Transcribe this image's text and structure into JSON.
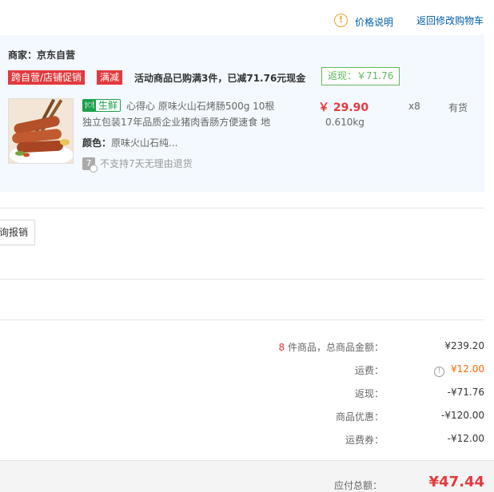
{
  "header": {
    "price_desc": "价格说明",
    "back_to_cart": "返回修改购物车"
  },
  "shop": {
    "merchant_label": "商家：",
    "merchant_name": "京东自营",
    "promo_tags": [
      "跨自营/店铺促销",
      "满减"
    ],
    "promo_text": "活动商品已购满3件，已减71.76元现金",
    "cashback": "返现：￥71.76"
  },
  "item": {
    "fresh_icon": "🍽",
    "fresh_label": "生鲜",
    "title_line1": "心得心 原味火山石烤肠500g 10根",
    "title_line2": "独立包装17年品质企业猪肉香肠方便速食 地",
    "color_label": "颜色：",
    "color_value": "原味火山石纯...",
    "return_icon": "7",
    "return_text": "不支持7天无理由退货",
    "price": "￥ 29.90",
    "weight": "0.610kg",
    "qty": "x8",
    "stock": "有货"
  },
  "expense_button": "询报销",
  "summary": {
    "count": "8",
    "count_suffix": " 件商品，总商品金额：",
    "amount": "¥239.20",
    "shipping_label": "运费：",
    "shipping_value": "¥12.00",
    "cashback_label": "返现：",
    "cashback_value": "-¥71.76",
    "discount_label": "商品优惠：",
    "discount_value": "-¥120.00",
    "coupon_label": "运费券：",
    "coupon_value": "-¥12.00",
    "total_label": "应付总额：",
    "total_value": "¥47.44"
  },
  "colors": {
    "accent_red": "#e4393c",
    "link_blue": "#005ea7",
    "fresh_green": "#1aa14a",
    "shop_bg": "#f3f9fe"
  }
}
